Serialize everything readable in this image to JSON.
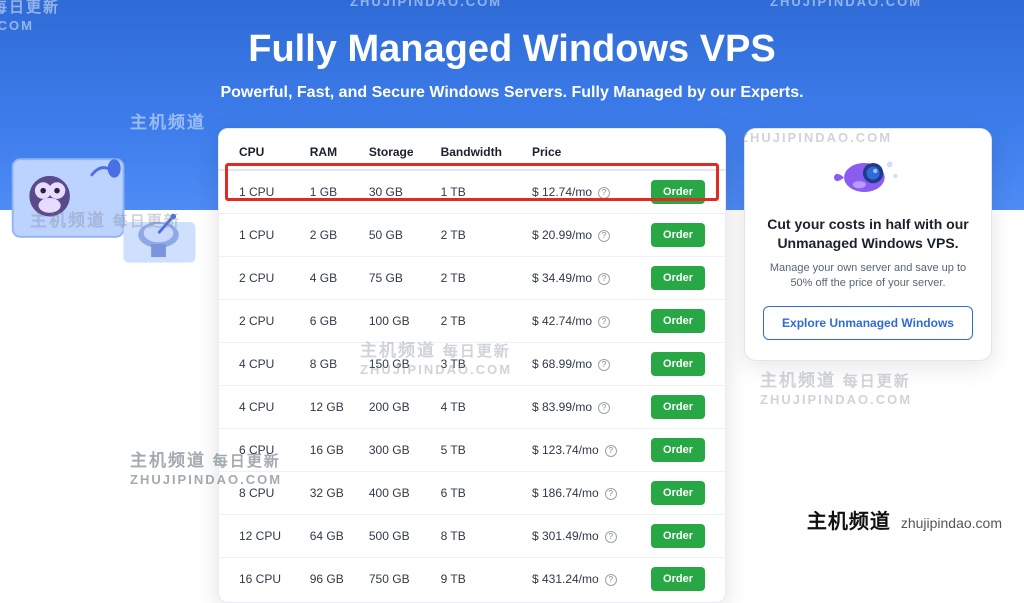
{
  "hero": {
    "title": "Fully Managed Windows VPS",
    "subtitle": "Powerful, Fast, and Secure Windows Servers. Fully Managed by our Experts."
  },
  "table": {
    "headers": {
      "cpu": "CPU",
      "ram": "RAM",
      "storage": "Storage",
      "bandwidth": "Bandwidth",
      "price": "Price"
    },
    "order_label": "Order",
    "rows": [
      {
        "cpu": "1 CPU",
        "ram": "1 GB",
        "storage": "30 GB",
        "bandwidth": "1 TB",
        "price": "$ 12.74/mo"
      },
      {
        "cpu": "1 CPU",
        "ram": "2 GB",
        "storage": "50 GB",
        "bandwidth": "2 TB",
        "price": "$ 20.99/mo"
      },
      {
        "cpu": "2 CPU",
        "ram": "4 GB",
        "storage": "75 GB",
        "bandwidth": "2 TB",
        "price": "$ 34.49/mo"
      },
      {
        "cpu": "2 CPU",
        "ram": "6 GB",
        "storage": "100 GB",
        "bandwidth": "2 TB",
        "price": "$ 42.74/mo"
      },
      {
        "cpu": "4 CPU",
        "ram": "8 GB",
        "storage": "150 GB",
        "bandwidth": "3 TB",
        "price": "$ 68.99/mo"
      },
      {
        "cpu": "4 CPU",
        "ram": "12 GB",
        "storage": "200 GB",
        "bandwidth": "4 TB",
        "price": "$ 83.99/mo"
      },
      {
        "cpu": "6 CPU",
        "ram": "16 GB",
        "storage": "300 GB",
        "bandwidth": "5 TB",
        "price": "$ 123.74/mo"
      },
      {
        "cpu": "8 CPU",
        "ram": "32 GB",
        "storage": "400 GB",
        "bandwidth": "6 TB",
        "price": "$ 186.74/mo"
      },
      {
        "cpu": "12 CPU",
        "ram": "64 GB",
        "storage": "500 GB",
        "bandwidth": "8 TB",
        "price": "$ 301.49/mo"
      },
      {
        "cpu": "16 CPU",
        "ram": "96 GB",
        "storage": "750 GB",
        "bandwidth": "9 TB",
        "price": "$ 431.24/mo"
      }
    ]
  },
  "sidebar": {
    "headline": "Cut your costs in half with our Unmanaged Windows VPS.",
    "body": "Manage your own server and save up to 50% off the price of your server.",
    "cta": "Explore Unmanaged Windows"
  },
  "watermark": {
    "cn_main": "主机频道",
    "cn_sub": "每日更新",
    "en": "ZHUJIPINDAO.COM",
    "brand_en": "zhujipindao.com"
  }
}
